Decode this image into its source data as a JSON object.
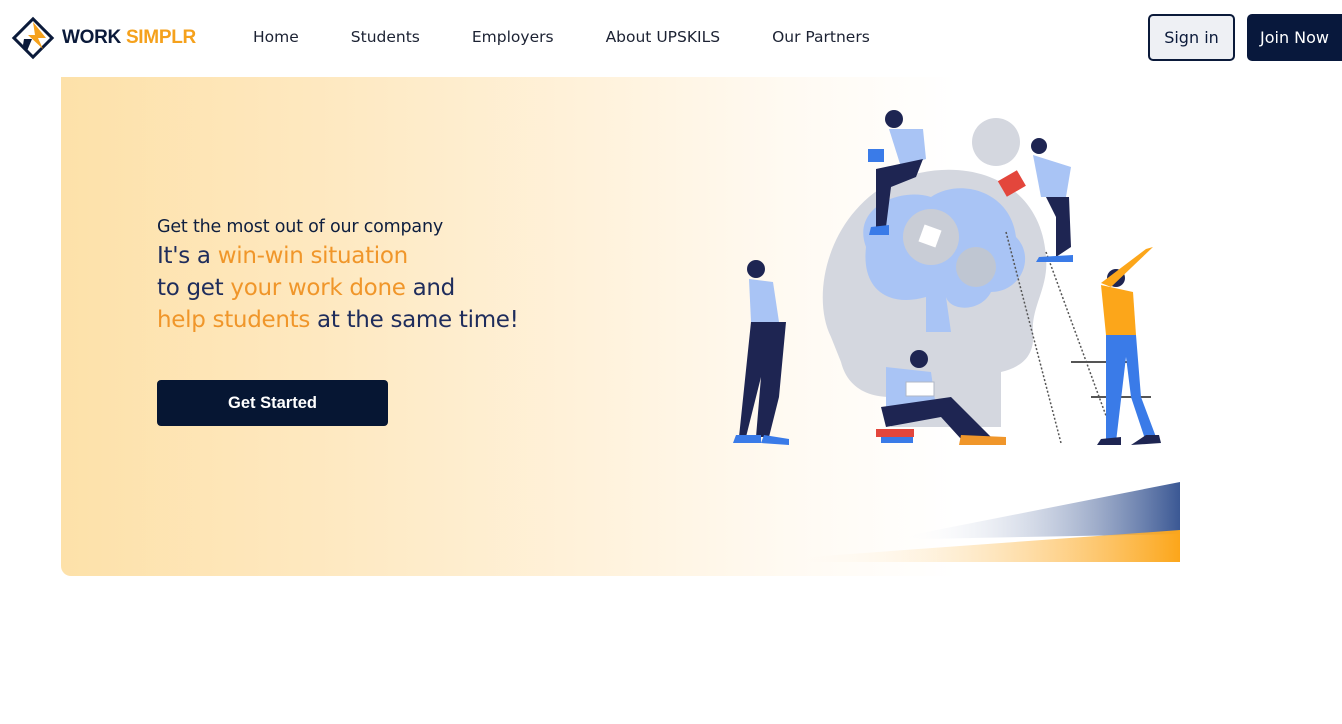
{
  "brand": {
    "part1": "WORK ",
    "part2": "SIMPLR",
    "icon": "worksimplr-logo-icon"
  },
  "nav": {
    "items": [
      "Home",
      "Students",
      "Employers",
      "About UPSKILS",
      "Our Partners"
    ]
  },
  "auth": {
    "sign_in": "Sign in",
    "join_now": "Join Now"
  },
  "hero": {
    "eyebrow": "Get the most out of our company",
    "line1_a": "It's a ",
    "line1_b": "win-win situation",
    "line2_a": "to get ",
    "line2_b": "your work done",
    "line2_c": " and",
    "line3_a": "help students",
    "line3_b": " at the same time!",
    "cta": "Get Started",
    "illustration": "team-brainstorm-illustration"
  },
  "colors": {
    "navy": "#08183c",
    "accent": "#f0962a",
    "hero_bg": "#fde1a9"
  }
}
